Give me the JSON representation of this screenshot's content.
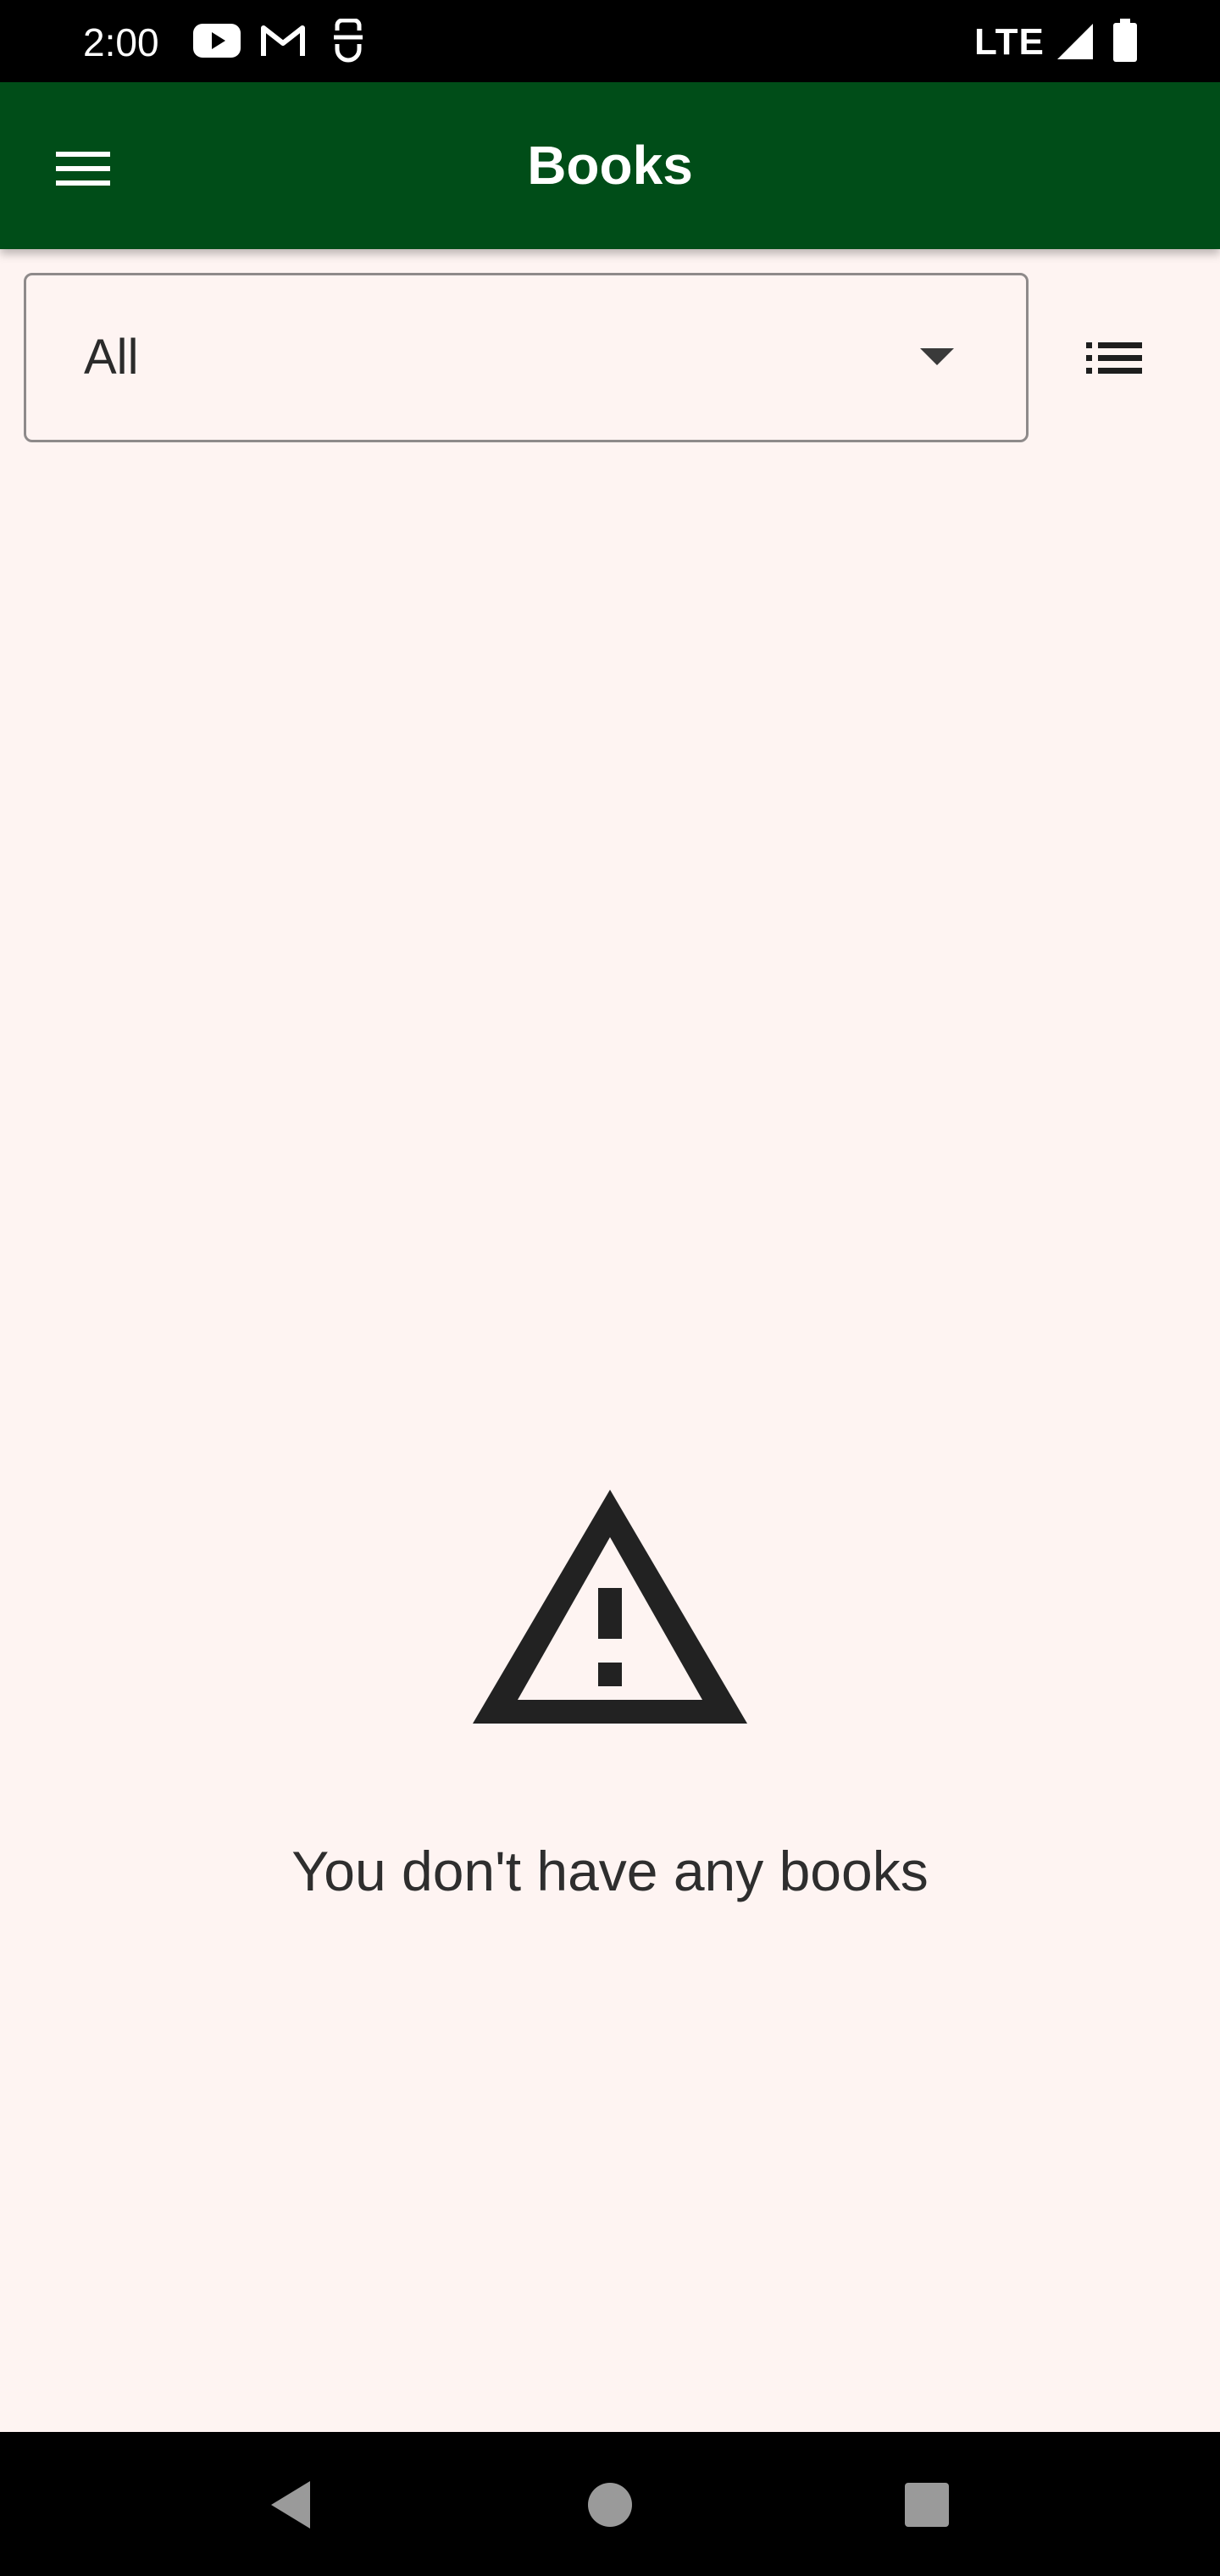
{
  "status_bar": {
    "time": "2:00",
    "network": "LTE",
    "icons": [
      "youtube-icon",
      "gmail-icon",
      "notification-app-icon",
      "signal-icon",
      "battery-icon"
    ]
  },
  "app_bar": {
    "title": "Books",
    "menu_icon": "hamburger-menu-icon",
    "background_color": "#004d18"
  },
  "filter": {
    "selected": "All",
    "arrow_icon": "dropdown-arrow-icon"
  },
  "view_toggle": {
    "icon": "list-view-icon"
  },
  "empty_state": {
    "icon": "warning-icon",
    "message": "You don't have any books"
  },
  "nav_bar": {
    "buttons": [
      "back-icon",
      "home-icon",
      "recents-icon"
    ]
  }
}
